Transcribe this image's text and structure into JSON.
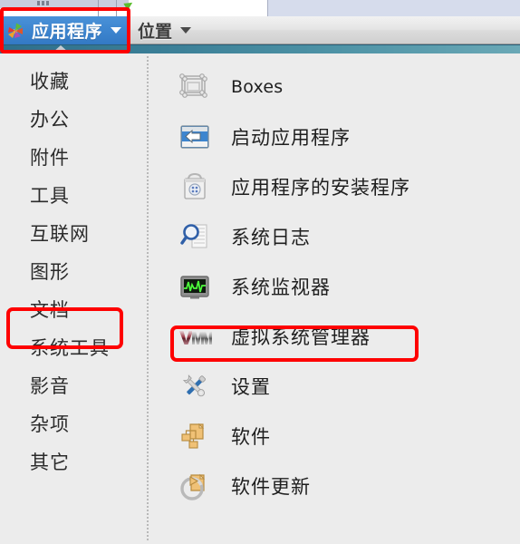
{
  "panel": {
    "applications_menu": {
      "label": "应用程序",
      "icon": "gnome-foot-icon",
      "caret": "chevron-down-icon",
      "active": true
    },
    "places_menu": {
      "label": "位置",
      "caret": "chevron-down-icon",
      "active": false
    }
  },
  "colors": {
    "menu_active_bg": "#3d85cf",
    "panel_bg": "#e4e4e4",
    "menu_body_bg": "#ececec",
    "annotation_red": "#fe0000",
    "teal_bar_left": "#2e6f8b",
    "teal_bar_right": "#6aa8b6"
  },
  "categories": [
    {
      "label": "收藏",
      "selected": false
    },
    {
      "label": "办公",
      "selected": false
    },
    {
      "label": "附件",
      "selected": false
    },
    {
      "label": "工具",
      "selected": false
    },
    {
      "label": "互联网",
      "selected": false
    },
    {
      "label": "图形",
      "selected": false
    },
    {
      "label": "文档",
      "selected": false
    },
    {
      "label": "系统工具",
      "selected": true
    },
    {
      "label": "影音",
      "selected": false
    },
    {
      "label": "杂项",
      "selected": false
    },
    {
      "label": "其它",
      "selected": false
    }
  ],
  "applications": [
    {
      "label": "Boxes",
      "icon": "boxes-icon",
      "latin": true,
      "highlighted": false
    },
    {
      "label": "启动应用程序",
      "icon": "app-launcher-icon",
      "latin": false,
      "highlighted": false
    },
    {
      "label": "应用程序的安装程序",
      "icon": "package-installer-icon",
      "latin": false,
      "highlighted": false
    },
    {
      "label": "系统日志",
      "icon": "system-log-icon",
      "latin": false,
      "highlighted": false
    },
    {
      "label": "系统监视器",
      "icon": "system-monitor-icon",
      "latin": false,
      "highlighted": false
    },
    {
      "label": "虚拟系统管理器",
      "icon": "virt-manager-icon",
      "latin": false,
      "highlighted": true
    },
    {
      "label": "设置",
      "icon": "settings-tools-icon",
      "latin": false,
      "highlighted": false
    },
    {
      "label": "软件",
      "icon": "software-icon",
      "latin": false,
      "highlighted": false
    },
    {
      "label": "软件更新",
      "icon": "software-update-icon",
      "latin": false,
      "highlighted": false
    }
  ],
  "annotations": [
    {
      "name": "applications-menu-highlight",
      "target": "应用程序"
    },
    {
      "name": "system-tools-category-highlight",
      "target": "系统工具"
    },
    {
      "name": "virt-manager-item-highlight",
      "target": "虚拟系统管理器"
    }
  ]
}
